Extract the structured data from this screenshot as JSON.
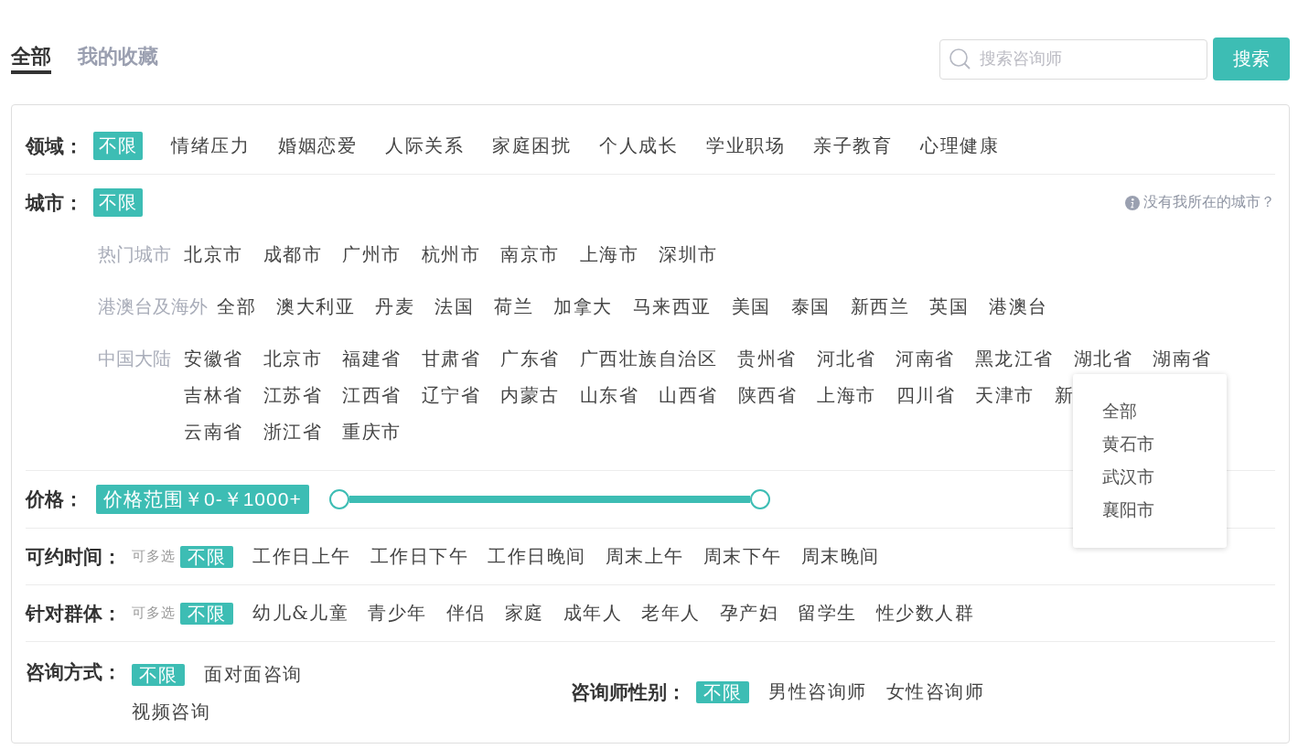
{
  "tabs": [
    {
      "label": "全部",
      "selected": true
    },
    {
      "label": "我的收藏",
      "selected": false
    }
  ],
  "search": {
    "placeholder": "搜索咨询师",
    "button": "搜索"
  },
  "filters": [
    {
      "kind": "tags",
      "label": "领域：",
      "options": [
        {
          "label": "不限",
          "selected": true
        },
        {
          "label": "情绪压力",
          "selected": false
        },
        {
          "label": "婚姻恋爱",
          "selected": false
        },
        {
          "label": "人际关系",
          "selected": false
        },
        {
          "label": "家庭困扰",
          "selected": false
        },
        {
          "label": "个人成长",
          "selected": false
        },
        {
          "label": "学业职场",
          "selected": false
        },
        {
          "label": "亲子教育",
          "selected": false
        },
        {
          "label": "心理健康",
          "selected": false
        }
      ]
    },
    {
      "kind": "city",
      "label": "城市：",
      "options": [
        {
          "label": "不限",
          "selected": true
        }
      ],
      "help_link": "没有我所在的城市？",
      "groups": [
        {
          "label": "热门城市",
          "lines": [
            [
              "北京市",
              "成都市",
              "广州市",
              "杭州市",
              "南京市",
              "上海市",
              "深圳市"
            ]
          ]
        },
        {
          "label": "港澳台及海外",
          "lines": [
            [
              "全部",
              "澳大利亚",
              "丹麦",
              "法国",
              "荷兰",
              "加拿大",
              "马来西亚",
              "美国",
              "泰国",
              "新西兰",
              "英国",
              "港澳台"
            ]
          ]
        },
        {
          "label": "中国大陆",
          "lines": [
            [
              "安徽省",
              "北京市",
              "福建省",
              "甘肃省",
              "广东省",
              "广西壮族自治区",
              "贵州省",
              "河北省",
              "河南省",
              "黑龙江省",
              "湖北省",
              "湖南省"
            ],
            [
              "吉林省",
              "江苏省",
              "江西省",
              "辽宁省",
              "内蒙古",
              "山东省",
              "山西省",
              "陕西省",
              "上海市",
              "四川省",
              "天津市",
              "新"
            ],
            [
              "云南省",
              "浙江省",
              "重庆市"
            ]
          ],
          "popup": {
            "items": [
              "全部",
              "黄石市",
              "武汉市",
              "襄阳市"
            ]
          }
        }
      ]
    },
    {
      "kind": "price",
      "label": "价格：",
      "range_tag": "价格范围￥0-￥1000+",
      "slider": {
        "level": 1
      }
    },
    {
      "kind": "tags",
      "label": "可约时间：",
      "hint": "可多选",
      "options": [
        {
          "label": "不限",
          "selected": true
        },
        {
          "label": "工作日上午",
          "selected": false
        },
        {
          "label": "工作日下午",
          "selected": false
        },
        {
          "label": "工作日晚间",
          "selected": false
        },
        {
          "label": "周末上午",
          "selected": false
        },
        {
          "label": "周末下午",
          "selected": false
        },
        {
          "label": "周末晚间",
          "selected": false
        }
      ]
    },
    {
      "kind": "tags",
      "label": "针对群体：",
      "hint": "可多选",
      "options": [
        {
          "label": "不限",
          "selected": true
        },
        {
          "label": "幼儿&儿童",
          "selected": false
        },
        {
          "label": "青少年",
          "selected": false
        },
        {
          "label": "伴侣",
          "selected": false
        },
        {
          "label": "家庭",
          "selected": false
        },
        {
          "label": "成年人",
          "selected": false
        },
        {
          "label": "老年人",
          "selected": false
        },
        {
          "label": "孕产妇",
          "selected": false
        },
        {
          "label": "留学生",
          "selected": false
        },
        {
          "label": "性少数人群",
          "selected": false
        }
      ]
    },
    {
      "kind": "pair",
      "groups": [
        {
          "label": "咨询方式：",
          "options": [
            {
              "label": "不限",
              "selected": true
            },
            {
              "label": "面对面咨询",
              "selected": false
            },
            {
              "label": "视频咨询",
              "selected": false
            }
          ]
        },
        {
          "label": "咨询师性别：",
          "options": [
            {
              "label": "不限",
              "selected": true
            },
            {
              "label": "男性咨询师",
              "selected": false
            },
            {
              "label": "女性咨询师",
              "selected": false
            }
          ]
        }
      ]
    }
  ]
}
